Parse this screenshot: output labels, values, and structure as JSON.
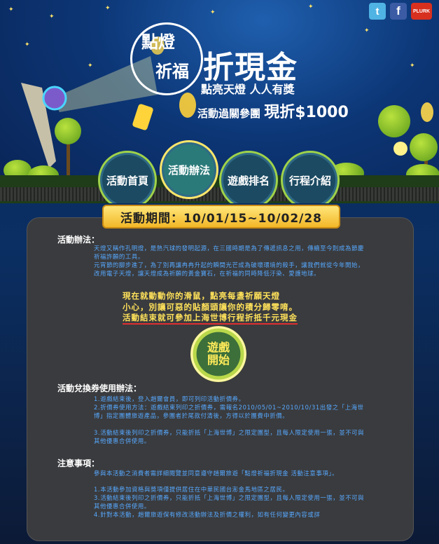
{
  "social": {
    "twitter_label": "t",
    "facebook_label": "f",
    "plurk_label": "PLURK"
  },
  "logo": {
    "line1": "點燈",
    "line2": "祈福"
  },
  "header": {
    "title": "折現金",
    "subtitle": "點亮天燈 人人有獎",
    "promo_prefix": "活動過關參團",
    "promo_highlight": "現折$1000"
  },
  "nav": [
    {
      "label": "活動首頁"
    },
    {
      "label": "活動辦法"
    },
    {
      "label": "遊戲排名"
    },
    {
      "label": "行程介紹"
    }
  ],
  "period": {
    "label": "活動期間：10/01/15~10/02/28"
  },
  "sections": {
    "rules": {
      "title": "活動辦法：",
      "paragraphs": [
        "天燈又稱作孔明燈，是熱汽球的發明起源，在三國時期是為了傳遞訊息之用，傳續至今則成為節慶祈福許願的工具。",
        "元宵節的腳步進了，為了別再讓冉冉升起的瞬間光芒成為破壞環境的殺手，讓我們就從今年開始，改用電子天燈，讓天燈成為祈願的黃金寶石，在祈福的同時降低汙染、愛護地球。"
      ],
      "highlight": [
        "現在就動動你的滑鼠，點亮每盞祈願天燈",
        "小心，別讓可惡的貼顏頭讓你的積分歸零唷。",
        "活動結束就可參加上海世博行程折抵千元現金"
      ]
    },
    "play_button": {
      "line1": "遊戲",
      "line2": "開始"
    },
    "voucher": {
      "title": "活動兌換券使用辦法：",
      "items": [
        "1.遊戲結束後，登入趙爾會員，即可列印活動折價券。",
        "2.折價券使用方法：遊戲結束列印之折價券，需報名2010/05/01~2010/10/31出發之「上海世博」指定團體旅遊產品，參團者於尾款付清後，方得以於團費中折價。",
        "3.活動結束後列印之折價券，只能折抵「上海世博」之限定團型，且每人限定使用一張，並不可與其他優惠合併使用。"
      ]
    },
    "notes": {
      "title": "注意事項：",
      "items": [
        "參與本活動之消費者需詳細閱覽並同意遵守趙爾旅遊「點燈祈福折現金 活動注意事項」。",
        "1.本活動參加資格與獎項僅提供居住在中華民國台澎金馬地區之居民。",
        "3.活動結束後列印之折價券，只能折抵「上海世博」之限定團型，且每人限定使用一張，並不可與其他優惠合併使用。",
        "4.針對本活動，趙爾旅遊保有修改活動辦法及折價之權利，如有任何變更內容或詳"
      ]
    }
  }
}
